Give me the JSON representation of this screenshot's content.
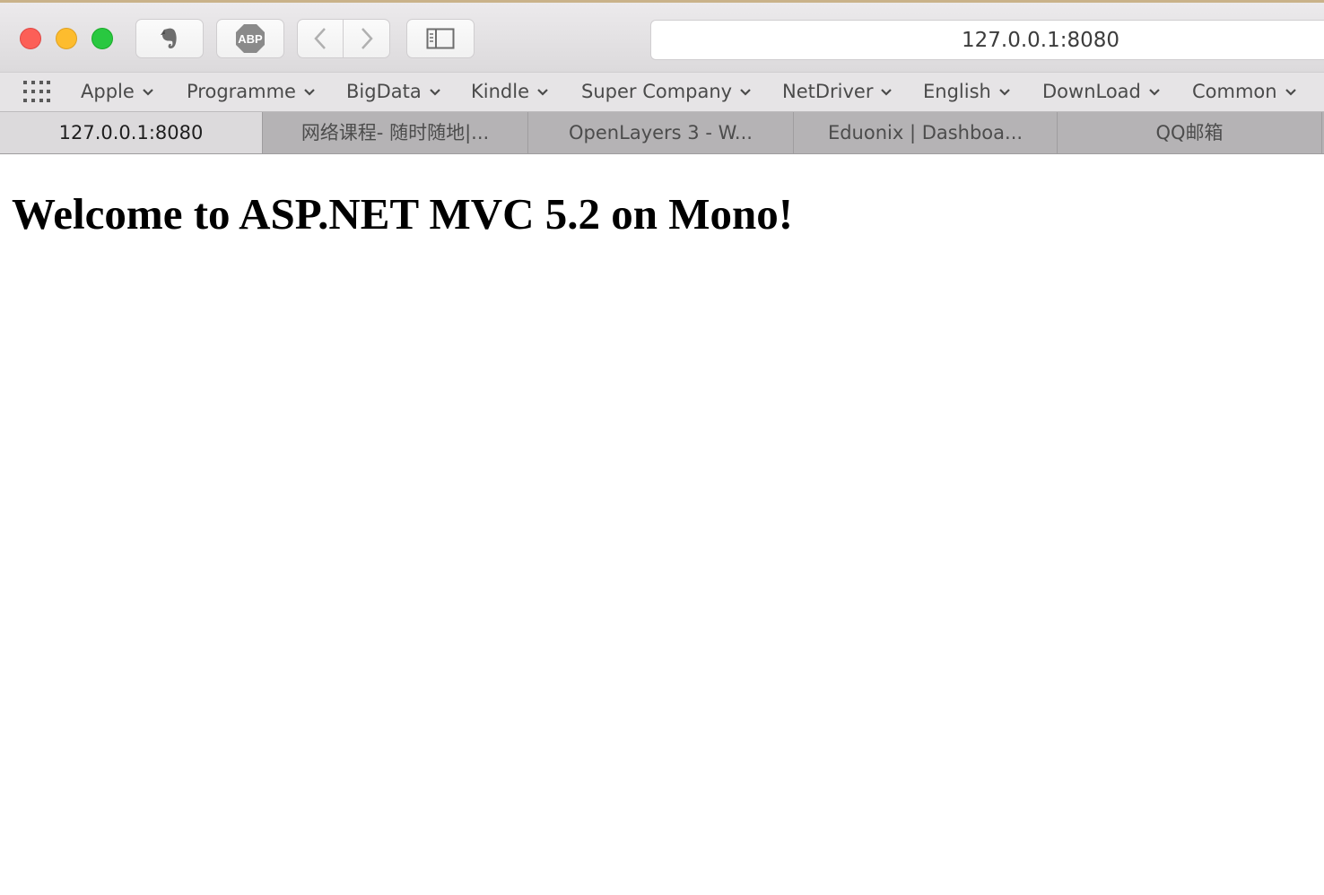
{
  "window": {
    "address": "127.0.0.1:8080"
  },
  "toolbar": {
    "evernote_icon": "evernote-icon",
    "abp_label": "ABP",
    "back_icon": "chevron-left-icon",
    "forward_icon": "chevron-right-icon",
    "sidebar_icon": "sidebar-icon"
  },
  "bookmarks": [
    {
      "label": "Apple"
    },
    {
      "label": "Programme"
    },
    {
      "label": "BigData"
    },
    {
      "label": "Kindle"
    },
    {
      "label": "Super Company"
    },
    {
      "label": "NetDriver"
    },
    {
      "label": "English"
    },
    {
      "label": "DownLoad"
    },
    {
      "label": "Common"
    }
  ],
  "tabs": [
    {
      "label": "127.0.0.1:8080",
      "active": true
    },
    {
      "label": "网络课程- 随时随地|...",
      "active": false
    },
    {
      "label": "OpenLayers 3 - W...",
      "active": false
    },
    {
      "label": "Eduonix | Dashboa...",
      "active": false
    },
    {
      "label": "QQ邮箱",
      "active": false
    }
  ],
  "page": {
    "heading": "Welcome to ASP.NET MVC 5.2 on Mono!"
  },
  "colors": {
    "close": "#fc5f57",
    "minimize": "#fdbc2e",
    "maximize": "#29c840",
    "tab_bar": "#b5b3b5",
    "active_tab": "#dcdadc"
  }
}
